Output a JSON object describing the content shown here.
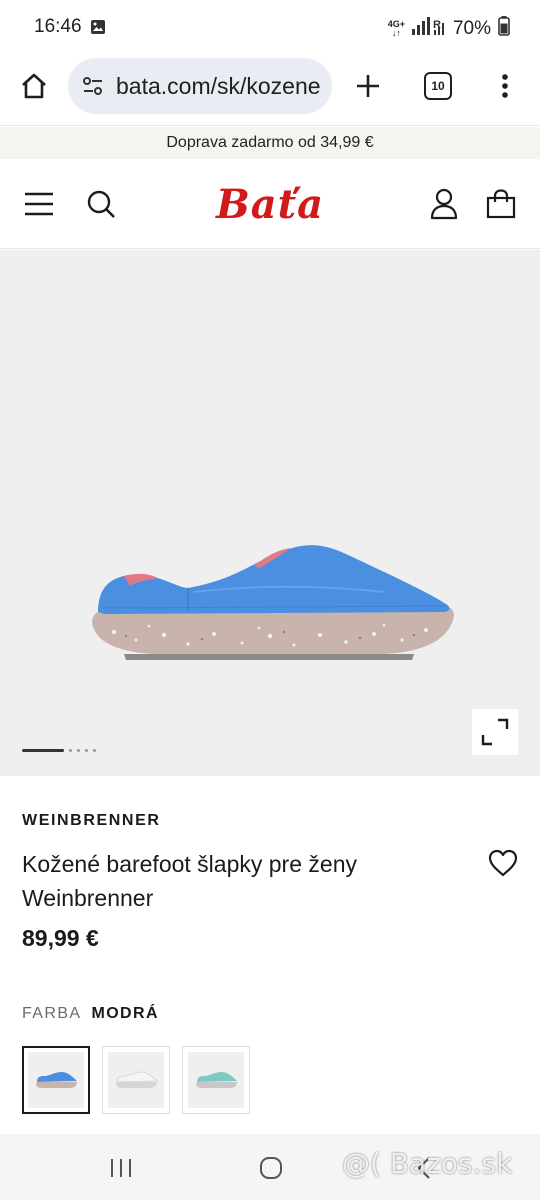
{
  "status_bar": {
    "time": "16:46",
    "network_top": "4G+",
    "network_bottom": "↓↑",
    "signal_label": "R",
    "battery": "70%",
    "icons": [
      "image-icon",
      "signal-icon",
      "battery-icon"
    ]
  },
  "browser": {
    "url": "bata.com/sk/kozene",
    "tab_count": "10",
    "icons": [
      "home-icon",
      "site-settings-icon",
      "plus-icon",
      "more-vert-icon"
    ]
  },
  "promo": {
    "text": "Doprava zadarmo od 34,99 €"
  },
  "header": {
    "logo": "Baťa",
    "icons": [
      "hamburger-icon",
      "search-icon",
      "user-icon",
      "bag-icon"
    ]
  },
  "gallery": {
    "image": "blue leather clog shoe",
    "slide_count": 5,
    "active_slide": 1,
    "icons": [
      "expand-icon"
    ]
  },
  "product": {
    "brand": "WEINBRENNER",
    "title": "Kožené barefoot šlapky pre ženy Weinbrenner",
    "price": "89,99 €",
    "color_label": "FARBA",
    "color_value": "MODRÁ",
    "swatches": [
      {
        "color": "blue",
        "hex": "#4a8fe0",
        "selected": true
      },
      {
        "color": "white",
        "hex": "#e8e8ee",
        "selected": false
      },
      {
        "color": "mint",
        "hex": "#7fc9c4",
        "selected": false
      }
    ]
  },
  "nav": {
    "icons": [
      "recent-apps-icon",
      "home-circle-icon",
      "back-icon"
    ]
  },
  "watermark": {
    "text": "@( Bazos.sk"
  },
  "colors": {
    "brand_red": "#d31a1a",
    "promo_bg": "#f4f4f0",
    "gallery_bg": "#efefef",
    "shoe_blue": "#4a8fe0"
  }
}
